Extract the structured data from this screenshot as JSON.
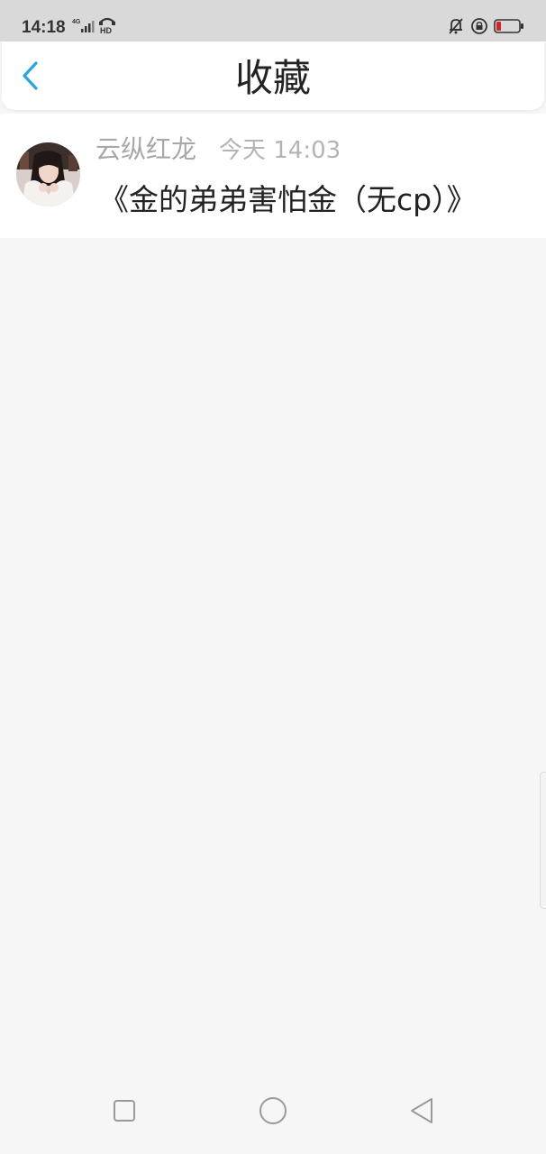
{
  "status_bar": {
    "time": "14:18",
    "icons": [
      "signal-4g-icon",
      "hd-call-icon",
      "mute-bell-icon",
      "lock-rotation-icon",
      "battery-low-icon"
    ],
    "battery_color": "#e02020"
  },
  "header": {
    "title": "收藏",
    "back_icon": "chevron-left-icon",
    "back_color": "#2aa3e6"
  },
  "favorites": [
    {
      "author": "云纵红龙",
      "time": "今天 14:03",
      "content": "《金的弟弟害怕金（无cp）》",
      "avatar_icon": "user-avatar"
    }
  ],
  "system_nav": {
    "icons": [
      "recent-apps-square-icon",
      "home-circle-icon",
      "back-triangle-icon"
    ]
  }
}
